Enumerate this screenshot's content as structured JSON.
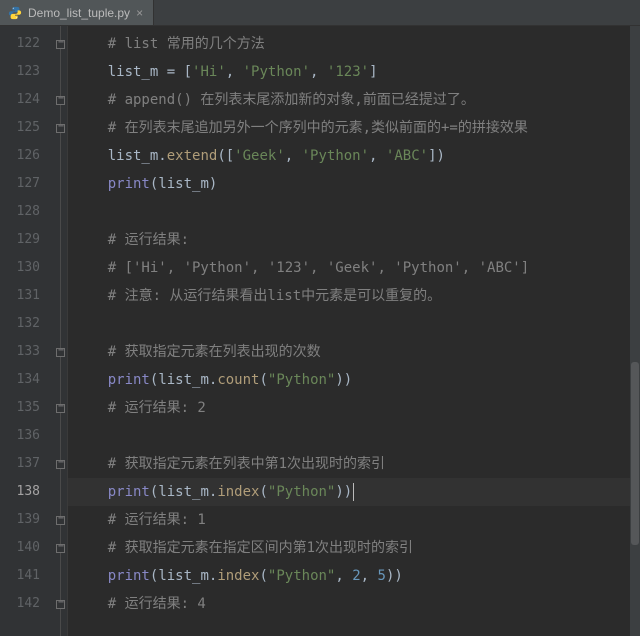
{
  "tab": {
    "filename": "Demo_list_tuple.py",
    "close_glyph": "×"
  },
  "gutter": {
    "start": 122,
    "end": 142,
    "current": 138
  },
  "fold_marks": [
    122,
    124,
    125,
    133,
    135,
    137,
    139,
    140,
    142
  ],
  "lines": [
    {
      "n": 122,
      "indent": 1,
      "tokens": [
        {
          "cls": "c-comment",
          "t": "# list 常用的几个方法"
        }
      ]
    },
    {
      "n": 123,
      "indent": 1,
      "tokens": [
        {
          "cls": "c-ident",
          "t": "list_m "
        },
        {
          "cls": "c-op",
          "t": "= "
        },
        {
          "cls": "c-punc",
          "t": "["
        },
        {
          "cls": "c-str",
          "t": "'Hi'"
        },
        {
          "cls": "c-punc",
          "t": ", "
        },
        {
          "cls": "c-str",
          "t": "'Python'"
        },
        {
          "cls": "c-punc",
          "t": ", "
        },
        {
          "cls": "c-str",
          "t": "'123'"
        },
        {
          "cls": "c-punc",
          "t": "]"
        }
      ]
    },
    {
      "n": 124,
      "indent": 1,
      "tokens": [
        {
          "cls": "c-comment",
          "t": "# append() 在列表末尾添加新的对象,前面已经提过了。"
        }
      ]
    },
    {
      "n": 125,
      "indent": 1,
      "tokens": [
        {
          "cls": "c-comment",
          "t": "# 在列表末尾追加另外一个序列中的元素,类似前面的+=的拼接效果"
        }
      ]
    },
    {
      "n": 126,
      "indent": 1,
      "tokens": [
        {
          "cls": "c-ident",
          "t": "list_m."
        },
        {
          "cls": "c-func",
          "t": "extend"
        },
        {
          "cls": "c-punc",
          "t": "(["
        },
        {
          "cls": "c-str",
          "t": "'Geek'"
        },
        {
          "cls": "c-punc",
          "t": ", "
        },
        {
          "cls": "c-str",
          "t": "'Python'"
        },
        {
          "cls": "c-punc",
          "t": ", "
        },
        {
          "cls": "c-str",
          "t": "'ABC'"
        },
        {
          "cls": "c-punc",
          "t": "])"
        }
      ]
    },
    {
      "n": 127,
      "indent": 1,
      "tokens": [
        {
          "cls": "c-builtin",
          "t": "print"
        },
        {
          "cls": "c-punc",
          "t": "("
        },
        {
          "cls": "c-ident",
          "t": "list_m"
        },
        {
          "cls": "c-punc",
          "t": ")"
        }
      ]
    },
    {
      "n": 128,
      "indent": 0,
      "tokens": []
    },
    {
      "n": 129,
      "indent": 1,
      "tokens": [
        {
          "cls": "c-comment",
          "t": "# 运行结果:"
        }
      ]
    },
    {
      "n": 130,
      "indent": 1,
      "tokens": [
        {
          "cls": "c-comment",
          "t": "# ['Hi', 'Python', '123', 'Geek', 'Python', 'ABC']"
        }
      ]
    },
    {
      "n": 131,
      "indent": 1,
      "tokens": [
        {
          "cls": "c-comment",
          "t": "# 注意: 从运行结果看出list中元素是可以重复的。"
        }
      ]
    },
    {
      "n": 132,
      "indent": 0,
      "tokens": []
    },
    {
      "n": 133,
      "indent": 1,
      "tokens": [
        {
          "cls": "c-comment",
          "t": "# 获取指定元素在列表出现的次数"
        }
      ]
    },
    {
      "n": 134,
      "indent": 1,
      "tokens": [
        {
          "cls": "c-builtin",
          "t": "print"
        },
        {
          "cls": "c-punc",
          "t": "("
        },
        {
          "cls": "c-ident",
          "t": "list_m."
        },
        {
          "cls": "c-func",
          "t": "count"
        },
        {
          "cls": "c-punc",
          "t": "("
        },
        {
          "cls": "c-str",
          "t": "\"Python\""
        },
        {
          "cls": "c-punc",
          "t": "))"
        }
      ]
    },
    {
      "n": 135,
      "indent": 1,
      "tokens": [
        {
          "cls": "c-comment",
          "t": "# 运行结果: 2"
        }
      ]
    },
    {
      "n": 136,
      "indent": 0,
      "tokens": []
    },
    {
      "n": 137,
      "indent": 1,
      "tokens": [
        {
          "cls": "c-comment",
          "t": "# 获取指定元素在列表中第1次出现时的索引"
        }
      ]
    },
    {
      "n": 138,
      "indent": 1,
      "current": true,
      "tokens": [
        {
          "cls": "c-builtin",
          "t": "print"
        },
        {
          "cls": "c-punc",
          "t": "("
        },
        {
          "cls": "c-ident",
          "t": "list_m."
        },
        {
          "cls": "c-func",
          "t": "index"
        },
        {
          "cls": "c-punc",
          "t": "("
        },
        {
          "cls": "c-str",
          "t": "\"Python\""
        },
        {
          "cls": "c-punc",
          "t": "))"
        }
      ],
      "caret": true
    },
    {
      "n": 139,
      "indent": 1,
      "tokens": [
        {
          "cls": "c-comment",
          "t": "# 运行结果: 1"
        }
      ]
    },
    {
      "n": 140,
      "indent": 1,
      "tokens": [
        {
          "cls": "c-comment",
          "t": "# 获取指定元素在指定区间内第1次出现时的索引"
        }
      ]
    },
    {
      "n": 141,
      "indent": 1,
      "tokens": [
        {
          "cls": "c-builtin",
          "t": "print"
        },
        {
          "cls": "c-punc",
          "t": "("
        },
        {
          "cls": "c-ident",
          "t": "list_m."
        },
        {
          "cls": "c-func",
          "t": "index"
        },
        {
          "cls": "c-punc",
          "t": "("
        },
        {
          "cls": "c-str",
          "t": "\"Python\""
        },
        {
          "cls": "c-punc",
          "t": ", "
        },
        {
          "cls": "c-num",
          "t": "2"
        },
        {
          "cls": "c-punc",
          "t": ", "
        },
        {
          "cls": "c-num",
          "t": "5"
        },
        {
          "cls": "c-punc",
          "t": "))"
        }
      ]
    },
    {
      "n": 142,
      "indent": 1,
      "tokens": [
        {
          "cls": "c-comment",
          "t": "# 运行结果: 4"
        }
      ]
    }
  ],
  "scrollbar": {
    "top_pct": 55,
    "height_pct": 30
  }
}
